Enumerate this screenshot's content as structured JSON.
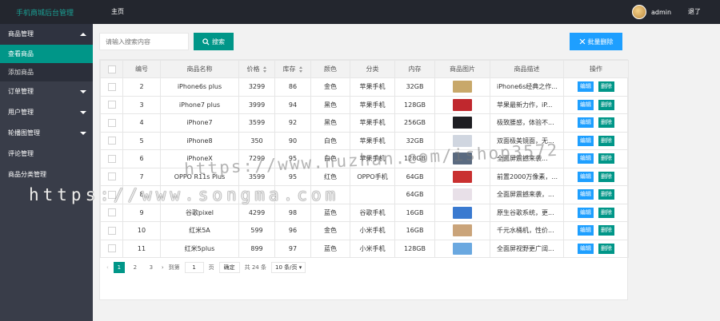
{
  "header": {
    "title": "手机商城后台管理",
    "nav_home": "主页",
    "user_name": "admin",
    "logout": "退了"
  },
  "sidebar": {
    "items": [
      {
        "label": "商品管理",
        "type": "group",
        "expanded": true
      },
      {
        "label": "查看商品",
        "type": "sub",
        "active": true
      },
      {
        "label": "添加商品",
        "type": "sub"
      },
      {
        "label": "订单管理",
        "type": "group"
      },
      {
        "label": "用户管理",
        "type": "group"
      },
      {
        "label": "轮播图管理",
        "type": "group"
      },
      {
        "label": "评论管理",
        "type": "plain"
      },
      {
        "label": "商品分类管理",
        "type": "plain"
      }
    ]
  },
  "toolbar": {
    "search_placeholder": "请输入搜索内容",
    "search_label": "搜索",
    "batch_delete_label": "批量删除"
  },
  "table": {
    "columns": [
      "编号",
      "商品名称",
      "价格",
      "库存",
      "颜色",
      "分类",
      "内存",
      "商品图片",
      "商品描述",
      "操作"
    ],
    "edit_label": "编辑",
    "delete_label": "删除",
    "rows": [
      {
        "id": "2",
        "name": "iPhone6s plus",
        "price": "3299",
        "stock": "86",
        "color": "金色",
        "category": "苹果手机",
        "memory": "32GB",
        "desc": "iPhone6s经典之作...",
        "thumb": "#c8a86a"
      },
      {
        "id": "3",
        "name": "iPhone7 plus",
        "price": "3999",
        "stock": "94",
        "color": "黑色",
        "category": "苹果手机",
        "memory": "128GB",
        "desc": "苹果最新力作，iP...",
        "thumb": "#c0282e"
      },
      {
        "id": "4",
        "name": "iPhone7",
        "price": "3599",
        "stock": "92",
        "color": "黑色",
        "category": "苹果手机",
        "memory": "256GB",
        "desc": "极致腰感，体验不...",
        "thumb": "#1e1e22"
      },
      {
        "id": "5",
        "name": "iPhone8",
        "price": "350",
        "stock": "90",
        "color": "白色",
        "category": "苹果手机",
        "memory": "32GB",
        "desc": "双面极美镜面，无...",
        "thumb": "#d0d6e0"
      },
      {
        "id": "6",
        "name": "iPhoneX",
        "price": "7299",
        "stock": "95",
        "color": "白色",
        "category": "苹果手机",
        "memory": "128GB",
        "desc": "全面屏震撼来袭...",
        "thumb": "#5a6a80"
      },
      {
        "id": "7",
        "name": "OPPO R11s Plus",
        "price": "3599",
        "stock": "95",
        "color": "红色",
        "category": "OPPO手机",
        "memory": "64GB",
        "desc": "前置2000万像素，...",
        "thumb": "#c93030"
      },
      {
        "id": "8",
        "name": "",
        "price": "",
        "stock": "",
        "color": "",
        "category": "",
        "memory": "64GB",
        "desc": "全面屏震撼来袭，...",
        "thumb": "#e8e0e8"
      },
      {
        "id": "9",
        "name": "谷歌pixel",
        "price": "4299",
        "stock": "98",
        "color": "蓝色",
        "category": "谷歌手机",
        "memory": "16GB",
        "desc": "原生谷歌系统，更...",
        "thumb": "#3a7ad0"
      },
      {
        "id": "10",
        "name": "红米5A",
        "price": "599",
        "stock": "96",
        "color": "金色",
        "category": "小米手机",
        "memory": "16GB",
        "desc": "千元水桶机，性价...",
        "thumb": "#caa47a"
      },
      {
        "id": "11",
        "name": "红米5plus",
        "price": "899",
        "stock": "97",
        "color": "蓝色",
        "category": "小米手机",
        "memory": "128GB",
        "desc": "全面屏视野更广阔...",
        "thumb": "#6aa8e0"
      }
    ]
  },
  "pagination": {
    "pages": [
      "1",
      "2",
      "3"
    ],
    "current": "1",
    "goto_label": "到第",
    "goto_value": "1",
    "page_unit": "页",
    "confirm_label": "确定",
    "total_label": "共 24 条",
    "limit_label": "10 条/页"
  },
  "watermarks": {
    "line1": "https://www.huzhan.com/ishop3572",
    "line2": "https://www.songma.com"
  }
}
